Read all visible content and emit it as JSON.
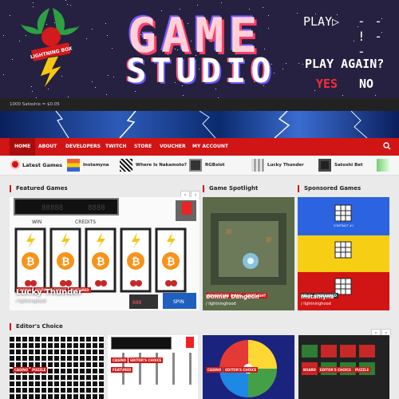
{
  "header": {
    "logo_text": "LIGHTNING BOX GAME STUDIO",
    "title_line1": "GAME",
    "title_line2": "STUDIO",
    "play_label": "PLAY▷",
    "dashes": "- - ! - -",
    "play_again": "PLAY AGAIN?",
    "yes_label": "YES",
    "no_label": "NO"
  },
  "rate_bar": {
    "text": "1000 Satoshis = $0.05"
  },
  "nav": {
    "items": [
      "HOME",
      "ABOUT",
      "DEVELOPERS",
      "TWITCH",
      "STORE",
      "VOUCHER",
      "MY ACCOUNT"
    ],
    "search_icon": "search-icon"
  },
  "ticker": {
    "label": "Latest Games",
    "items": [
      "Instamyna",
      "Where Is Nakamoto?",
      "RGBslot",
      "Lucky Thunder",
      "Satoshi Bet"
    ]
  },
  "featured": {
    "title": "Featured Games",
    "card": {
      "title": "Lucky Thunder",
      "author": "/ lightninghood",
      "badges": [
        "CASINO",
        "EDITOR'S CHOICE",
        "FEATURED"
      ],
      "slot_labels": {
        "win": "WIN",
        "credits": "CREDITS",
        "spin": "SPIN",
        "cash": "CASH",
        "out": "OUT"
      }
    }
  },
  "spotlight": {
    "title": "Game Spotlight",
    "card": {
      "title": "Donner Dungeon",
      "author": "/ lightninghood",
      "badges": [
        "ADVENTURE & RPG",
        "SPOTLIGHT"
      ]
    }
  },
  "sponsored": {
    "title": "Sponsored Games",
    "card": {
      "title": "Instamyna",
      "author": "/ lightninghood",
      "badges": [
        "IDLE",
        "SPONSORED"
      ],
      "panel_label": "CONTRACT #1"
    }
  },
  "editors": {
    "title": "Editor's Choice",
    "cards": [
      {
        "badges": [
          "CASINO",
          "PUZZLE"
        ]
      },
      {
        "badges": [
          "FEATURED"
        ],
        "inner_badges": [
          "CASINO",
          "EDITOR'S CHOICE"
        ]
      },
      {
        "badges": [
          "CASINO",
          "EDITOR'S CHOICE"
        ]
      },
      {
        "badges": [
          "BOARD",
          "EDITOR'S CHOICE",
          "PUZZLE"
        ]
      }
    ]
  },
  "colors": {
    "accent": "#d11414",
    "header_bg": "#262140",
    "storm": "#2d5bb8"
  }
}
